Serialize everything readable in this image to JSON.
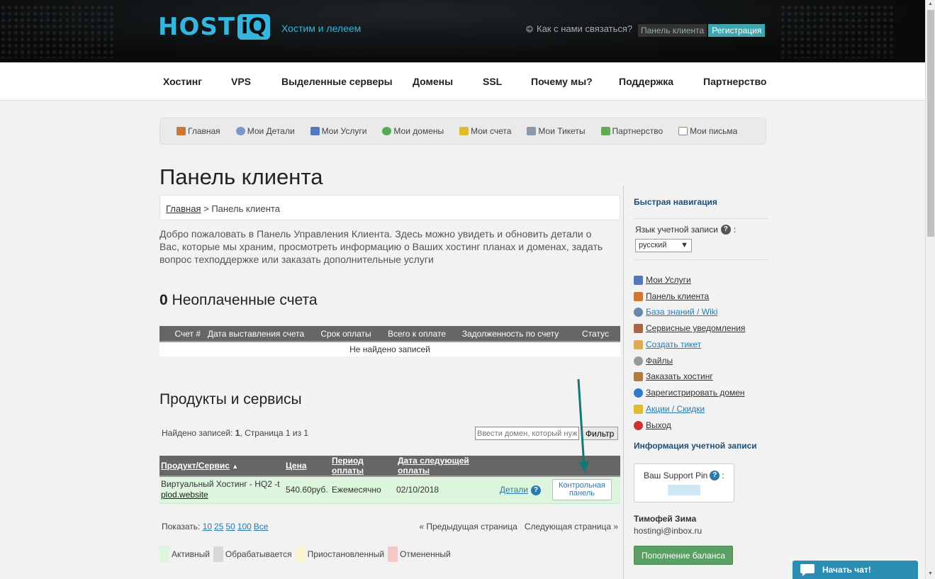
{
  "header": {
    "logo_text": "HOST",
    "logo_iq": "iQ",
    "tagline": "Хостим и лелеем",
    "contact": "Как с нами связаться?",
    "client_panel": "Панель клиента",
    "register": "Регистрация"
  },
  "main_nav": [
    "Хостинг",
    "VPS",
    "Выделенные серверы",
    "Домены",
    "SSL",
    "Почему мы?",
    "Поддержка",
    "Партнерство"
  ],
  "sub_nav": [
    "Главная",
    "Мои Детали",
    "Мои Услуги",
    "Мои домены",
    "Мои счета",
    "Мои Тикеты",
    "Партнерство",
    "Мои письма"
  ],
  "page_title": "Панель клиента",
  "breadcrumb": {
    "home": "Главная",
    "sep": " > ",
    "current": "Панель клиента"
  },
  "intro": "Добро пожаловать в Панель Управления Клиента. Здесь можно увидеть и обновить детали о Вас, которые мы храним, просмотреть информацию о Ваших хостинг планах и доменах, задать вопрос техподдержке или заказать дополнительные услуги",
  "unpaid": {
    "count": "0",
    "label": "Неоплаченные счета"
  },
  "invoices": {
    "headers": [
      "Счет #",
      "Дата выставления счета",
      "Срок оплаты",
      "Всего к оплате",
      "Задолженность по счету",
      "Статус"
    ],
    "empty": "Не найдено записей"
  },
  "products": {
    "title": "Продукты и сервисы",
    "found_prefix": "Найдено записей: ",
    "found_count": "1",
    "found_suffix": ", Страница 1 из 1",
    "filter_placeholder": "Ввести домен, который нужно",
    "filter_button": "Фильтр",
    "headers": [
      "Продукт/Сервис",
      "Цена",
      "Период оплаты",
      "Дата следующей оплаты"
    ],
    "sort_arrow": "▲",
    "row": {
      "product": "Виртуальный Хостинг - HQ2 -t",
      "domain": "plod.website",
      "price": "540.60руб.",
      "period": "Ежемесячно",
      "next_date": "02/10/2018",
      "details": "Детали",
      "cp_line1": "Контрольная",
      "cp_line2": "панель"
    }
  },
  "pager": {
    "show_label": "Показать: ",
    "options": [
      "10",
      "25",
      "50",
      "100",
      "Все"
    ],
    "prev": "« Предыдущая страница",
    "next": "Следующая страница »"
  },
  "legend": [
    {
      "label": "Активный",
      "color": "#dcf5dc"
    },
    {
      "label": "Обрабатывается",
      "color": "#d8d8d8"
    },
    {
      "label": "Приостановленный",
      "color": "#fcf5d2"
    },
    {
      "label": "Отмененный",
      "color": "#f5c8c8"
    }
  ],
  "sidebar": {
    "quick_nav": "Быстрая навигация",
    "lang_label": "Язык учетной записи",
    "lang_colon": ":",
    "lang_value": "русский",
    "links": [
      {
        "label": "Мои Услуги",
        "icon": "chart-icon",
        "color": "#5577bb"
      },
      {
        "label": "Панель клиента",
        "icon": "home-icon",
        "color": "#cc7733"
      },
      {
        "label": "База знаний / Wiki",
        "icon": "magnifier-icon",
        "color": "#6688aa",
        "link": true
      },
      {
        "label": "Сервисные уведомления",
        "icon": "antenna-icon",
        "color": "#aa6644"
      },
      {
        "label": "Создать тикет",
        "icon": "note-icon",
        "color": "#ddaa55",
        "link": true
      },
      {
        "label": "Файлы",
        "icon": "disc-icon",
        "color": "#999999"
      },
      {
        "label": "Заказать хостинг",
        "icon": "box-icon",
        "color": "#b07a40"
      },
      {
        "label": "Зарегистрировать домен",
        "icon": "globe-icon",
        "color": "#3377cc"
      },
      {
        "label": "Акции / Скидки",
        "icon": "gift-icon",
        "color": "#ddbb33",
        "link": true
      },
      {
        "label": "Выход",
        "icon": "exit-icon",
        "color": "#cc3333"
      }
    ],
    "account_info": "Информация учетной записи",
    "pin_label": "Ваш Support Pin",
    "pin_colon": ":",
    "user_name": "Тимофей Зима",
    "user_email": "hostingi@inbox.ru",
    "topup": "Пополнение баланса"
  },
  "chat": "Начать чат!",
  "colors": {
    "accent": "#35b6de",
    "teal_arrow": "#137878"
  }
}
